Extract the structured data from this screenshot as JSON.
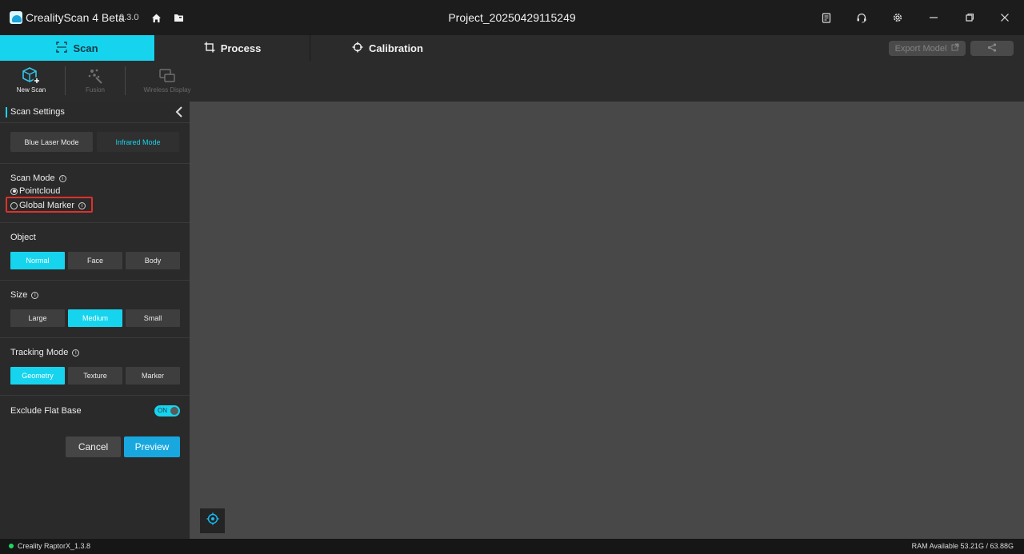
{
  "app": {
    "name": "CrealityScan 4 Beta",
    "version": "0.3.0"
  },
  "project": {
    "title": "Project_20250429115249"
  },
  "title_icons": [
    "home-icon",
    "folder-icon",
    "notes-icon",
    "headset-icon",
    "gear-icon",
    "minimize-icon",
    "restore-icon",
    "close-icon"
  ],
  "tabs": [
    {
      "label": "Scan",
      "icon": "scan-frame-icon",
      "active": true
    },
    {
      "label": "Process",
      "icon": "crop-icon",
      "active": false
    },
    {
      "label": "Calibration",
      "icon": "crosshair-icon",
      "active": false
    }
  ],
  "top_actions": {
    "export_label": "Export Model",
    "share_icon": "share-icon"
  },
  "toolbar": {
    "items": [
      {
        "label": "New Scan",
        "icon": "new-scan-cube-icon",
        "enabled": true
      },
      {
        "label": "Fusion",
        "icon": "fusion-icon",
        "enabled": false
      },
      {
        "label": "Wireless Display",
        "icon": "wireless-display-icon",
        "enabled": false
      }
    ]
  },
  "panel": {
    "title": "Scan Settings",
    "laser_modes": [
      {
        "label": "Blue Laser Mode",
        "selected": false
      },
      {
        "label": "Infrared Mode",
        "selected": true
      }
    ],
    "scan_mode": {
      "title": "Scan Mode",
      "options": [
        {
          "label": "Pointcloud",
          "checked": true
        },
        {
          "label": "Global Marker",
          "checked": false
        }
      ]
    },
    "object": {
      "title": "Object",
      "options": [
        "Normal",
        "Face",
        "Body"
      ],
      "selected": "Normal"
    },
    "size": {
      "title": "Size",
      "options": [
        "Large",
        "Medium",
        "Small"
      ],
      "selected": "Medium"
    },
    "tracking": {
      "title": "Tracking Mode",
      "options": [
        "Geometry",
        "Texture",
        "Marker"
      ],
      "selected": "Geometry"
    },
    "exclude_flat_base": {
      "label": "Exclude Flat Base",
      "toggle_label": "ON",
      "on": true
    },
    "cancel_label": "Cancel",
    "preview_label": "Preview"
  },
  "status": {
    "device": "Creality RaptorX_1.3.8",
    "ram": "RAM Available 53.21G / 63.88G"
  },
  "colors": {
    "accent": "#17d4ee",
    "highlight": "#e0302a",
    "connected": "#1ed760"
  }
}
